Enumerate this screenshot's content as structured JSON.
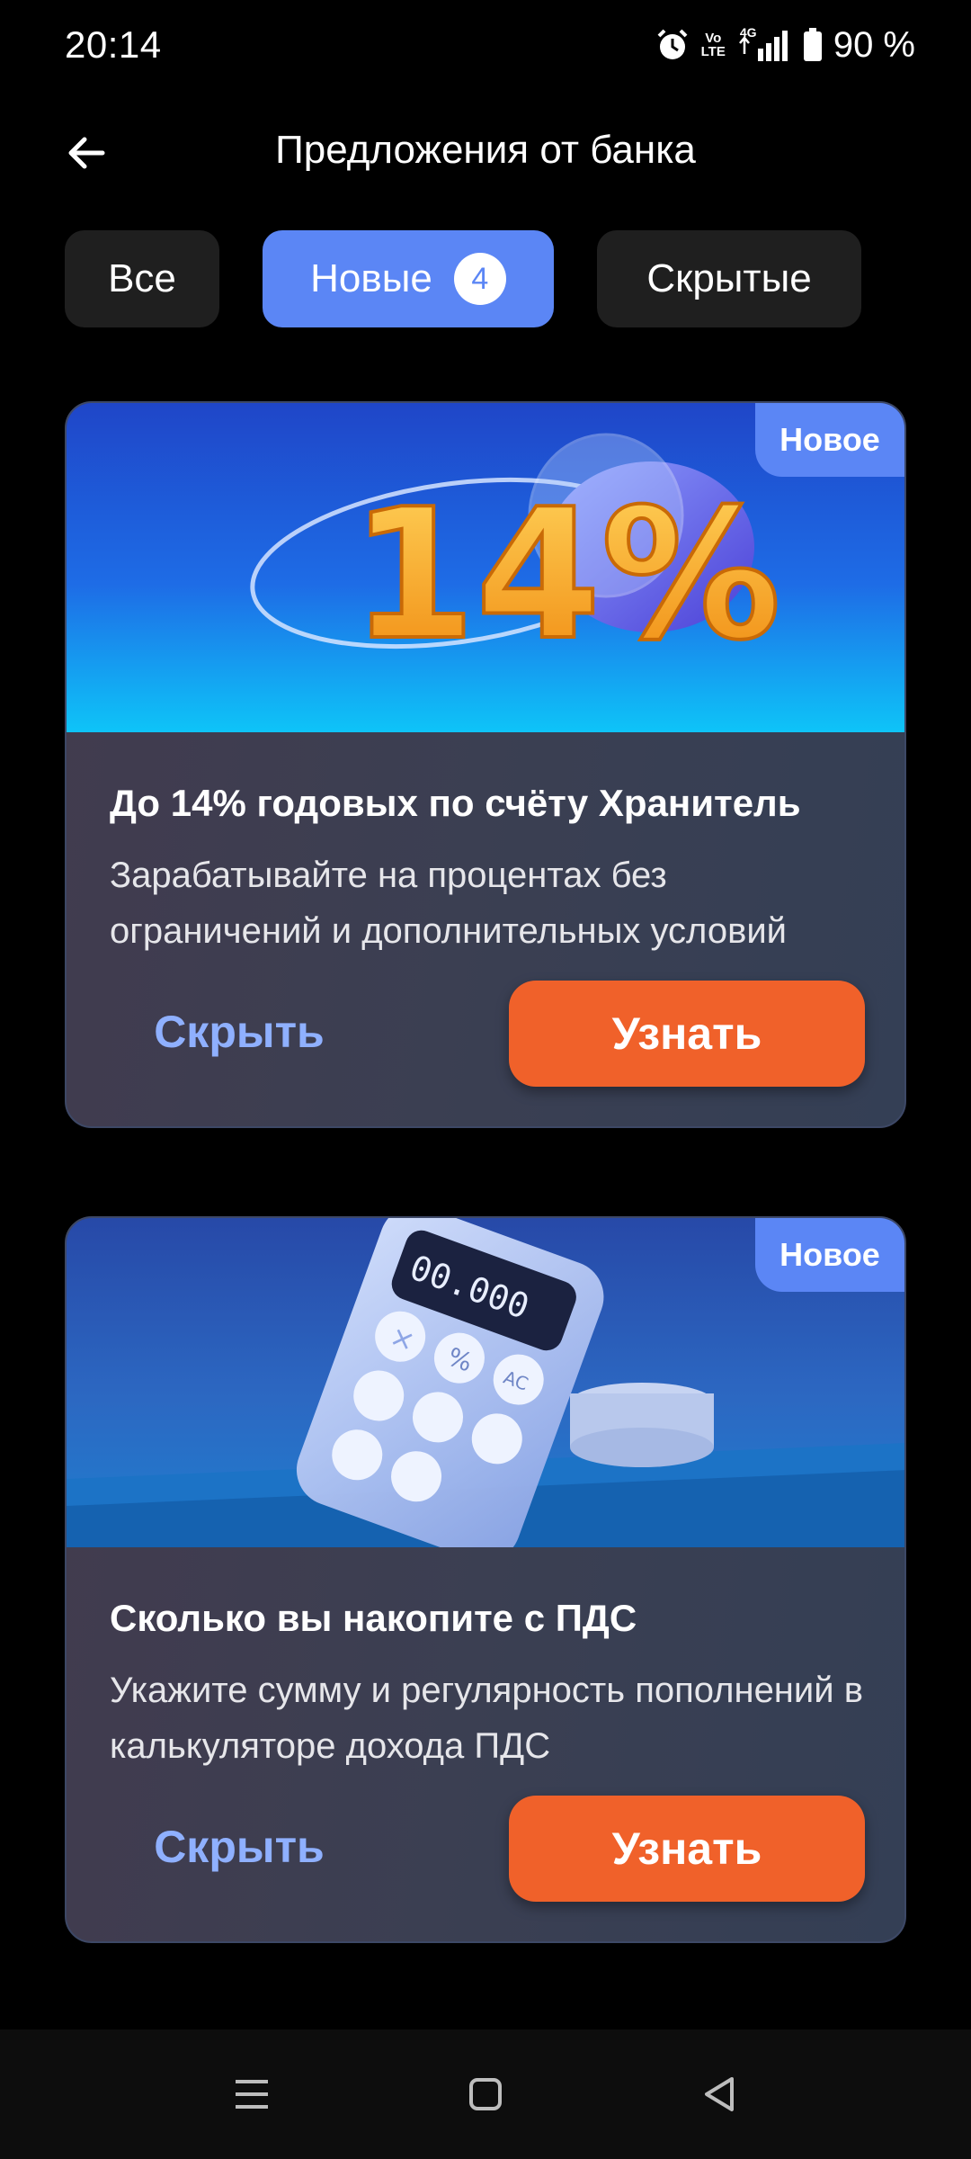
{
  "status_bar": {
    "time": "20:14",
    "volte_top": "Vo",
    "volte_bottom": "LTE",
    "network": "4G",
    "battery": "90 %"
  },
  "header": {
    "title": "Предложения от банка",
    "back_icon": "arrow-left-icon"
  },
  "tabs": [
    {
      "label": "Все",
      "active": false
    },
    {
      "label": "Новые",
      "active": true,
      "badge": "4"
    },
    {
      "label": "Скрытые",
      "active": false
    }
  ],
  "offers": [
    {
      "badge": "Новое",
      "banner_text": "14%",
      "title": "До 14% годовых по счёту Хранитель",
      "text": "Зарабатывайте на процентах без ограничений и дополнительных условий",
      "hide_label": "Скрыть",
      "learn_label": "Узнать"
    },
    {
      "badge": "Новое",
      "banner_text": "00.000",
      "calc_keys": [
        "%",
        "AC"
      ],
      "title": "Сколько вы накопите с ПДС",
      "text": "Укажите сумму и регулярность пополнений в калькуляторе дохода ПДС",
      "hide_label": "Скрыть",
      "learn_label": "Узнать"
    }
  ],
  "colors": {
    "accent": "#5b86f5",
    "action": "#f0612a",
    "link": "#8fb0ff",
    "background": "#000000"
  },
  "nav_bar": {
    "icons": [
      "menu-icon",
      "home-square-icon",
      "back-triangle-icon"
    ]
  }
}
